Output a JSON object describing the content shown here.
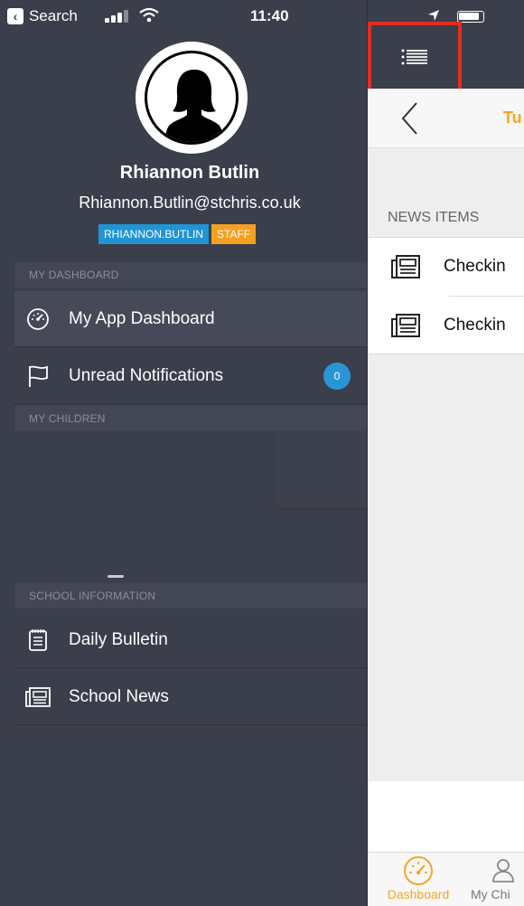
{
  "status_bar": {
    "back_app_label": "Search",
    "time": "11:40"
  },
  "profile": {
    "name": "Rhiannon Butlin",
    "email": "Rhiannon.Butlin@stchris.co.uk",
    "badges": [
      {
        "label": "RHIANNON.BUTLIN",
        "color": "#2195d3"
      },
      {
        "label": "STAFF",
        "color": "#f6a021"
      }
    ]
  },
  "drawer": {
    "sections": {
      "my_dashboard": "MY DASHBOARD",
      "my_children": "MY CHILDREN",
      "school_information": "SCHOOL INFORMATION"
    },
    "items": [
      {
        "label": "My App Dashboard",
        "icon": "speedometer-icon"
      },
      {
        "label": "Unread Notifications",
        "icon": "flag-icon",
        "count": "0"
      },
      {
        "label": "Daily Bulletin",
        "icon": "bulletin-icon"
      },
      {
        "label": "School News",
        "icon": "newspaper-icon"
      }
    ]
  },
  "main": {
    "date_label": "Tu",
    "news_header": "NEWS ITEMS",
    "news_items": [
      {
        "title": "Checkin",
        "icon": "newspaper-icon"
      },
      {
        "title": "Checkin",
        "icon": "newspaper-icon"
      }
    ],
    "tabs": [
      {
        "label": "Dashboard",
        "icon": "speedometer-icon",
        "active": true
      },
      {
        "label": "My Chi",
        "icon": "people-icon",
        "active": false
      }
    ]
  },
  "colors": {
    "drawer_bg": "#3b3e4b",
    "accent_orange": "#f5a623",
    "badge_blue": "#2195d3",
    "highlight_red": "#e22d22"
  }
}
